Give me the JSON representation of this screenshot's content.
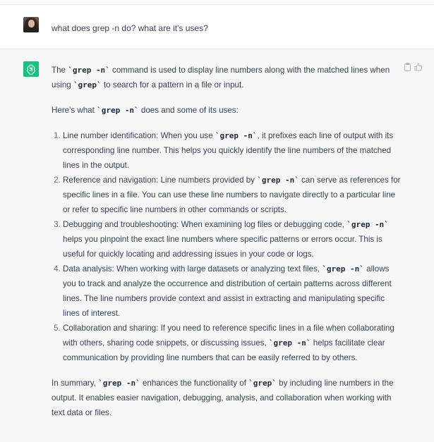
{
  "user": {
    "question": "what does grep -n do? what are it's uses?"
  },
  "assistant": {
    "intro": {
      "t1": "The ",
      "c1": "`grep -n`",
      "t2": " command is used to display line numbers along with the matched lines when using ",
      "c2": "`grep`",
      "t3": " to search for a pattern in a file or input."
    },
    "lead": {
      "t1": "Here's what ",
      "c1": "`grep -n`",
      "t2": " does and some of its uses:"
    },
    "items": [
      {
        "a": "Line number identification: When you use ",
        "c": "`grep -n`",
        "b": ", it prefixes each line of output with its corresponding line number. This helps you quickly identify the line numbers of the matched lines in the output."
      },
      {
        "a": "Reference and navigation: Line numbers provided by ",
        "c": "`grep -n`",
        "b": " can serve as references for specific lines in a file. You can use these line numbers to navigate directly to a particular line or refer to specific line numbers in other commands or scripts."
      },
      {
        "a": "Debugging and troubleshooting: When examining log files or debugging code, ",
        "c": "`grep -n`",
        "b": " helps you pinpoint the exact line numbers where specific patterns or errors occur. This is useful for quickly locating and addressing issues in your code or logs."
      },
      {
        "a": "Data analysis: When working with large datasets or analyzing text files, ",
        "c": "`grep -n`",
        "b": " allows you to track and analyze the occurrence and distribution of certain patterns across different lines. The line numbers provide context and assist in extracting and manipulating specific lines of interest."
      },
      {
        "a": "Collaboration and sharing: If you need to reference specific lines in a file when collaborating with others, sharing code snippets, or discussing issues, ",
        "c": "`grep -n`",
        "b": " helps facilitate clear communication by providing line numbers that can be easily referred to by others."
      }
    ],
    "summary": {
      "t1": "In summary, ",
      "c1": "`grep -n`",
      "t2": " enhances the functionality of ",
      "c2": "`grep`",
      "t3": " by including line numbers in the output. It enables easier navigation, debugging, analysis, and collaboration when working with text data or files."
    }
  },
  "icons": {
    "user_avatar": "user-avatar-photo",
    "assistant_avatar": "openai-logo-icon",
    "copy": "clipboard-icon",
    "like": "thumbs-up-icon"
  },
  "colors": {
    "assistant_bg": "#f7f7f8",
    "brand": "#19c37d",
    "text": "#374151"
  }
}
